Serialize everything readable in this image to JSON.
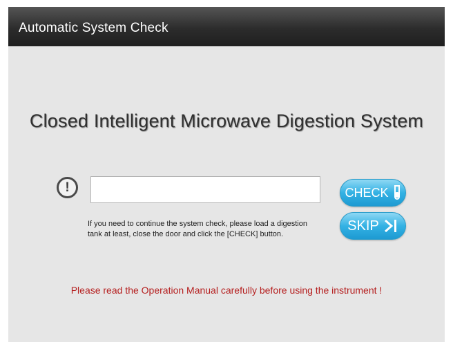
{
  "window": {
    "title": "Automatic System Check"
  },
  "main": {
    "heading": "Closed Intelligent Microwave Digestion System",
    "status_input": {
      "value": "",
      "placeholder": ""
    },
    "hint_line1": "If you need to continue the system check, please load a digestion",
    "hint_line2": "tank at least, close the door and click the [CHECK] button.",
    "check_label": "CHECK",
    "skip_label": "SKIP",
    "warning": "Please read the Operation Manual carefully before using the instrument !"
  },
  "icons": {
    "alert": "exclamation-circle-icon",
    "check": "test-tube-icon",
    "skip": "skip-to-end-icon"
  },
  "colors": {
    "titlebar": "#2c2c2c",
    "panel": "#e6e6e6",
    "button": "#34b2e4",
    "warning": "#b51f1f"
  }
}
